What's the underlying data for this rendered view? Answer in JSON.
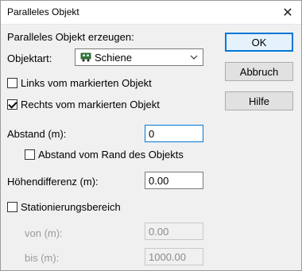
{
  "window": {
    "title": "Paralleles Objekt"
  },
  "group_heading": "Paralleles Objekt erzeugen:",
  "objektart": {
    "label": "Objektart:",
    "selected": "Schiene",
    "icon": "rail-vehicle-icon"
  },
  "options": {
    "links_label": "Links vom markierten Objekt",
    "links_checked": false,
    "rechts_label": "Rechts vom markierten Objekt",
    "rechts_checked": true
  },
  "abstand": {
    "label": "Abstand (m):",
    "value": "0"
  },
  "abstand_rand": {
    "label": "Abstand vom Rand des Objekts",
    "checked": false
  },
  "hoehendifferenz": {
    "label": "Höhendifferenz (m):",
    "value": "0.00"
  },
  "stationierung": {
    "label": "Stationierungsbereich",
    "checked": false,
    "von_label": "von (m):",
    "von_value": "0.00",
    "bis_label": "bis (m):",
    "bis_value": "1000.00"
  },
  "buttons": {
    "ok": "OK",
    "abbruch": "Abbruch",
    "hilfe": "Hilfe"
  }
}
